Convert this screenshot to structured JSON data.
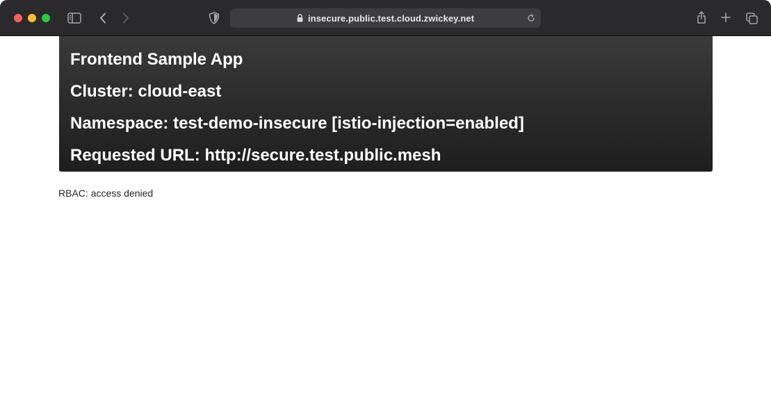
{
  "browser": {
    "address_bar": {
      "url": "insecure.public.test.cloud.zwickey.net"
    },
    "icons": {
      "close": "traffic-light-close",
      "minimize": "traffic-light-minimize",
      "maximize": "traffic-light-maximize",
      "sidebar": "sidebar-icon",
      "back": "chevron-left-icon",
      "forward": "chevron-right-icon",
      "privacy": "shield-icon",
      "lock": "lock-icon",
      "reload": "reload-icon",
      "share": "share-icon",
      "new_tab": "plus-icon",
      "tab_overview": "tabs-icon"
    },
    "colors": {
      "toolbar": "#2a2a2c",
      "address_bar": "#3d3d3f",
      "close": "#fe5f57",
      "minimize": "#febc2e",
      "maximize": "#28c840"
    }
  },
  "page": {
    "header": {
      "title": "Frontend Sample App",
      "cluster": "Cluster: cloud-east",
      "namespace": "Namespace: test-demo-insecure [istio-injection=enabled]",
      "requested_url": "Requested URL: http://secure.test.public.mesh"
    },
    "status": "RBAC: access denied",
    "colors": {
      "header_background": "#2b2b2b",
      "header_text": "#ffffff",
      "body_text": "#222222"
    }
  }
}
